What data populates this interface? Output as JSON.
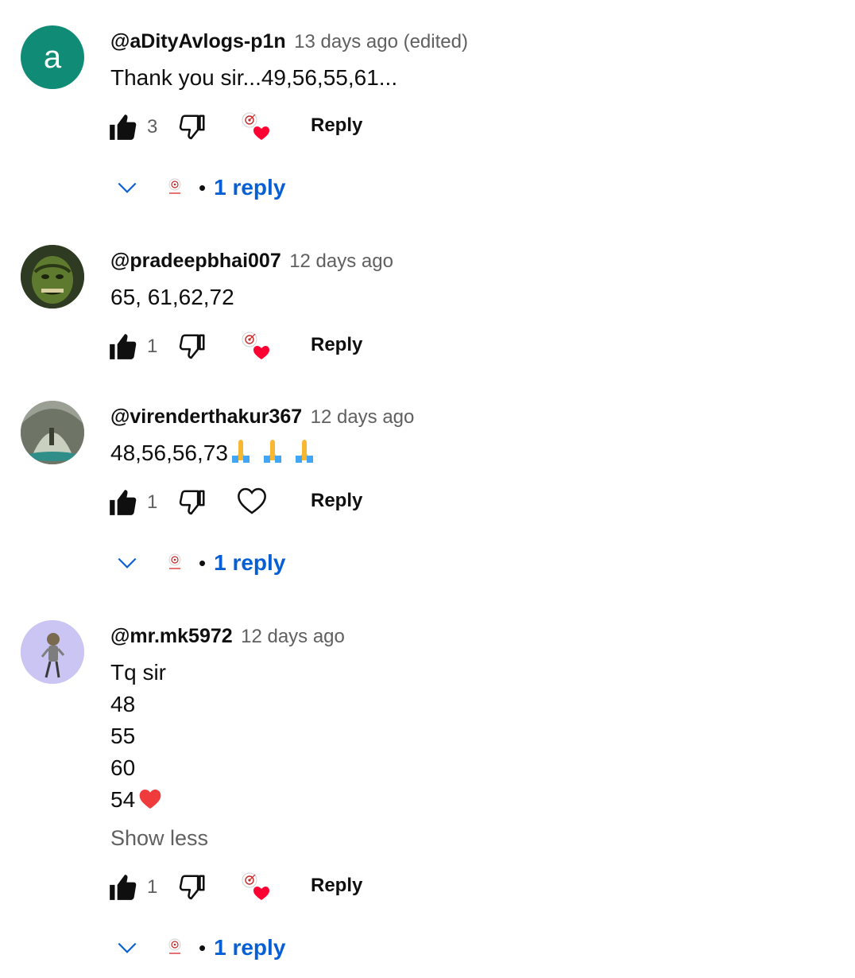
{
  "comments": [
    {
      "author": "@aDityAvlogs-p1n",
      "time": "13 days ago (edited)",
      "avatar_letter": "a",
      "lines": [
        "Thank you sir...49,56,55,61..."
      ],
      "likes": "3",
      "reply_label": "Reply",
      "replies_label": "1 reply",
      "creator_hearted": true
    },
    {
      "author": "@pradeepbhai007",
      "time": "12 days ago",
      "lines": [
        "65, 61,62,72"
      ],
      "likes": "1",
      "reply_label": "Reply",
      "creator_hearted": true
    },
    {
      "author": "@virenderthakur367",
      "time": "12 days ago",
      "lines": [
        "48,56,56,73"
      ],
      "emoji": "🙏🙏🙏",
      "likes": "1",
      "reply_label": "Reply",
      "replies_label": "1 reply",
      "creator_hearted": false
    },
    {
      "author": "@mr.mk5972",
      "time": "12 days ago",
      "lines": [
        "Tq sir",
        "48",
        "55",
        "60",
        "54"
      ],
      "emoji": "❤️",
      "show_less": "Show less",
      "likes": "1",
      "reply_label": "Reply",
      "replies_label": "1 reply",
      "creator_hearted": true
    }
  ],
  "colors": {
    "accent_link": "#065fd4",
    "secondary_text": "#606060",
    "heart": "#ff0033",
    "avatar_teal": "#0f8b76"
  }
}
